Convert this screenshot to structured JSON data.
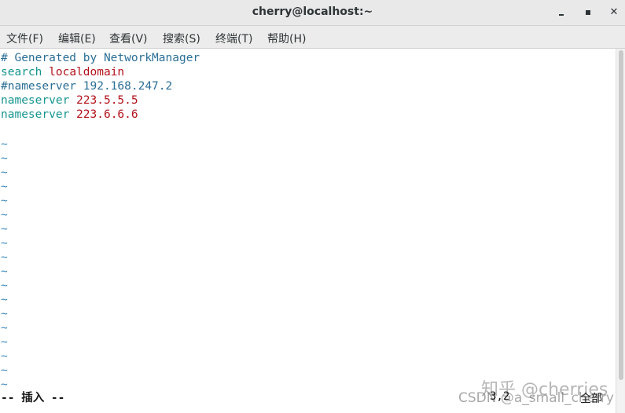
{
  "window": {
    "title": "cherry@localhost:~",
    "minimize_icon": "minimize-icon",
    "maximize_icon": "maximize-icon",
    "close_glyph": "✕"
  },
  "menu": {
    "items": [
      "文件(F)",
      "编辑(E)",
      "查看(V)",
      "搜索(S)",
      "终端(T)",
      "帮助(H)"
    ]
  },
  "editor": {
    "lines": [
      {
        "parts": [
          {
            "text": "# Generated by NetworkManager",
            "kind": "comment"
          }
        ]
      },
      {
        "parts": [
          {
            "text": "search",
            "kind": "keyword"
          },
          {
            "text": " ",
            "kind": "plain"
          },
          {
            "text": "localdomain",
            "kind": "value"
          }
        ]
      },
      {
        "parts": [
          {
            "text": "#nameserver 192.168.247.2",
            "kind": "comment"
          }
        ]
      },
      {
        "parts": [
          {
            "text": "nameserver",
            "kind": "keyword"
          },
          {
            "text": " ",
            "kind": "plain"
          },
          {
            "text": "223.5.5.5",
            "kind": "value"
          }
        ]
      },
      {
        "parts": [
          {
            "text": "nameserver",
            "kind": "keyword"
          },
          {
            "text": " ",
            "kind": "plain"
          },
          {
            "text": "223.6.6.6",
            "kind": "value"
          }
        ]
      }
    ],
    "tilde": "~",
    "tilde_count": 18
  },
  "status": {
    "mode": "-- 插入 --",
    "cursor_position": "3,2",
    "scroll_position": "全部"
  },
  "watermark": {
    "zhihu": "知乎 @cherries",
    "csdn": "CSDN @a_small_cherry"
  },
  "colors": {
    "comment": "#2b6f96",
    "keyword": "#15958f",
    "value": "#b3131b",
    "tilde": "#3c8bbf"
  }
}
